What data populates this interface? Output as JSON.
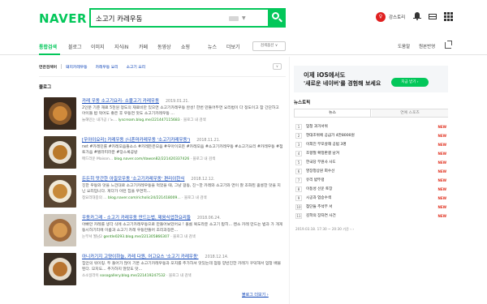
{
  "header": {
    "logo": "NAVER",
    "query": "소고기 카레우동",
    "user_name": "강스토리",
    "user_initial": "♀"
  },
  "tabs": [
    {
      "label": "통합검색",
      "active": true
    },
    {
      "label": "블로그"
    },
    {
      "label": "이미지"
    },
    {
      "label": "지식iN"
    },
    {
      "label": "카페"
    },
    {
      "label": "동영상"
    },
    {
      "label": "쇼핑"
    },
    {
      "label": "뉴스"
    },
    {
      "label": "더보기"
    }
  ],
  "search_options": "검색옵션 ∨",
  "tab_right": [
    "도움말",
    "원본반영"
  ],
  "related": {
    "label": "연관검색어",
    "queries": [
      "돼지카레우동",
      "카레우동 요리",
      "소고기 요리"
    ]
  },
  "section_title": "블로그",
  "blogs": [
    {
      "title": "카레 우동 소고기요리- 소불고기 카레우동",
      "date": "2019.01.21.",
      "desc": "2인분 기준 재료 5천원 정도의 재료비만 있으면 소고기카레우동 완성! 한번 만들어두면 요리법이 다 정도이고 참 간단하고 아이들 밥 먹어도 좋은 후 우동면 맛도 소고기카레우동 ...",
      "blogger": "늘해민는 내가공 / 노...",
      "url": "lyscream.blog.me/221447115683",
      "extra": "블로그 내 검색"
    },
    {
      "title": "[우아이요리] 카레우동 (니혼마카레우동 '소고기카레우동')",
      "date": "2018.11.21.",
      "desc": "net #카레민률 #카레모음들소스 #카레든은모음 #우아이모든 #카레모음 #소고기카레우동 #소고기요리 #카레우동 #점토가음 #텔라피라운 #장스록공방",
      "blogger": "메드라운 Maison...",
      "url": "blog.naver.com/dawon82/221420337426",
      "extra": "블로그 내 검색"
    },
    {
      "title": "든든히 맛간한 아낄모우동 '소고기카레우동' 편리이한식",
      "date": "2018.12.12.",
      "desc": "진한 우동와 맛을 느낀대로 소고기카레우동을 먹었을 때, 그냥 걸동, 진~한 카레와 소고기와 면이 잘 조화된 훌륭한 맛을 지닌 요리입니다. 게다가 이런 집을 우연히...",
      "blogger": "청요리대중의 ...",
      "url": "blog.naver.com/richolic24/221418009...",
      "extra": "블로그 내 검색"
    },
    {
      "title": "우동카그레 - 소고기 카레우동 만드는법, 제음식업한요리들",
      "date": "2018.06.24.",
      "desc": "아빠만 카레를 생각 식에 소고기카레우동으로 만들어보았어요 ! 볼륨 복도라운 소고기 탑히... 왠소 카레 만드는 법과 가 개게 동시하기리에 이름과 소고기 카레 우동만들어 조리과정은...",
      "blogger": "눈부셔 월남2",
      "url": "gentle0293.blog.me/221305866307",
      "extra": "블로그 내 검색"
    },
    {
      "title": "아니카기지 고양이하늘, 카레 다원, 어고요스 '소고기 카레우동'",
      "date": "2018.12.14.",
      "desc": "집안의 워이링. 두 들어가 많이 기본 소고기카레우동과 모지를 추가하셔 맛있는데 점등 양반진한 카레가 꾸덕해서 엄청 배불된다. 모지도... 추가하지 않았도 맛...",
      "blogger": "소소일라이",
      "url": "sosogallery.blog.me/221419247532",
      "extra": "블로그 내 검색"
    }
  ],
  "more_link": "블로그 더보기 ›",
  "ad": {
    "line1": "이제 iOS에서도",
    "line2": "'새로운 네이버'를 경험해 보세요",
    "button": "지금 받기 ›"
  },
  "news": {
    "title": "뉴스토픽",
    "tabs": [
      "뉴스",
      "연예 스포츠"
    ],
    "items": [
      {
        "rank": "1",
        "text": "엄청 과거서위",
        "new": "NEW"
      },
      {
        "rank": "2",
        "text": "현대조위에 공급가 4만8000원",
        "new": "NEW"
      },
      {
        "rank": "3",
        "text": "이희진 부모살해 공범 3명",
        "new": "NEW"
      },
      {
        "rank": "4",
        "text": "조향철 확정판결 남겨",
        "new": "NEW"
      },
      {
        "rank": "5",
        "text": "한국당 부원사 사도",
        "new": "NEW"
      },
      {
        "rank": "6",
        "text": "영장청상원 회수선",
        "new": "NEW"
      },
      {
        "rank": "7",
        "text": "유리 밤뚜렁",
        "new": "NEW"
      },
      {
        "rank": "8",
        "text": "이동성 선운 토장",
        "new": "NEW"
      },
      {
        "rank": "9",
        "text": "시공과 업승수색",
        "new": "NEW"
      },
      {
        "rank": "10",
        "text": "첨단들 추석부 서",
        "new": "NEW"
      },
      {
        "rank": "11",
        "text": "김학의 장자연 사건",
        "new": "NEW"
      }
    ],
    "footer": "2019.03.18. 17:30 ~ 20:30 기준 ‹ ›"
  }
}
